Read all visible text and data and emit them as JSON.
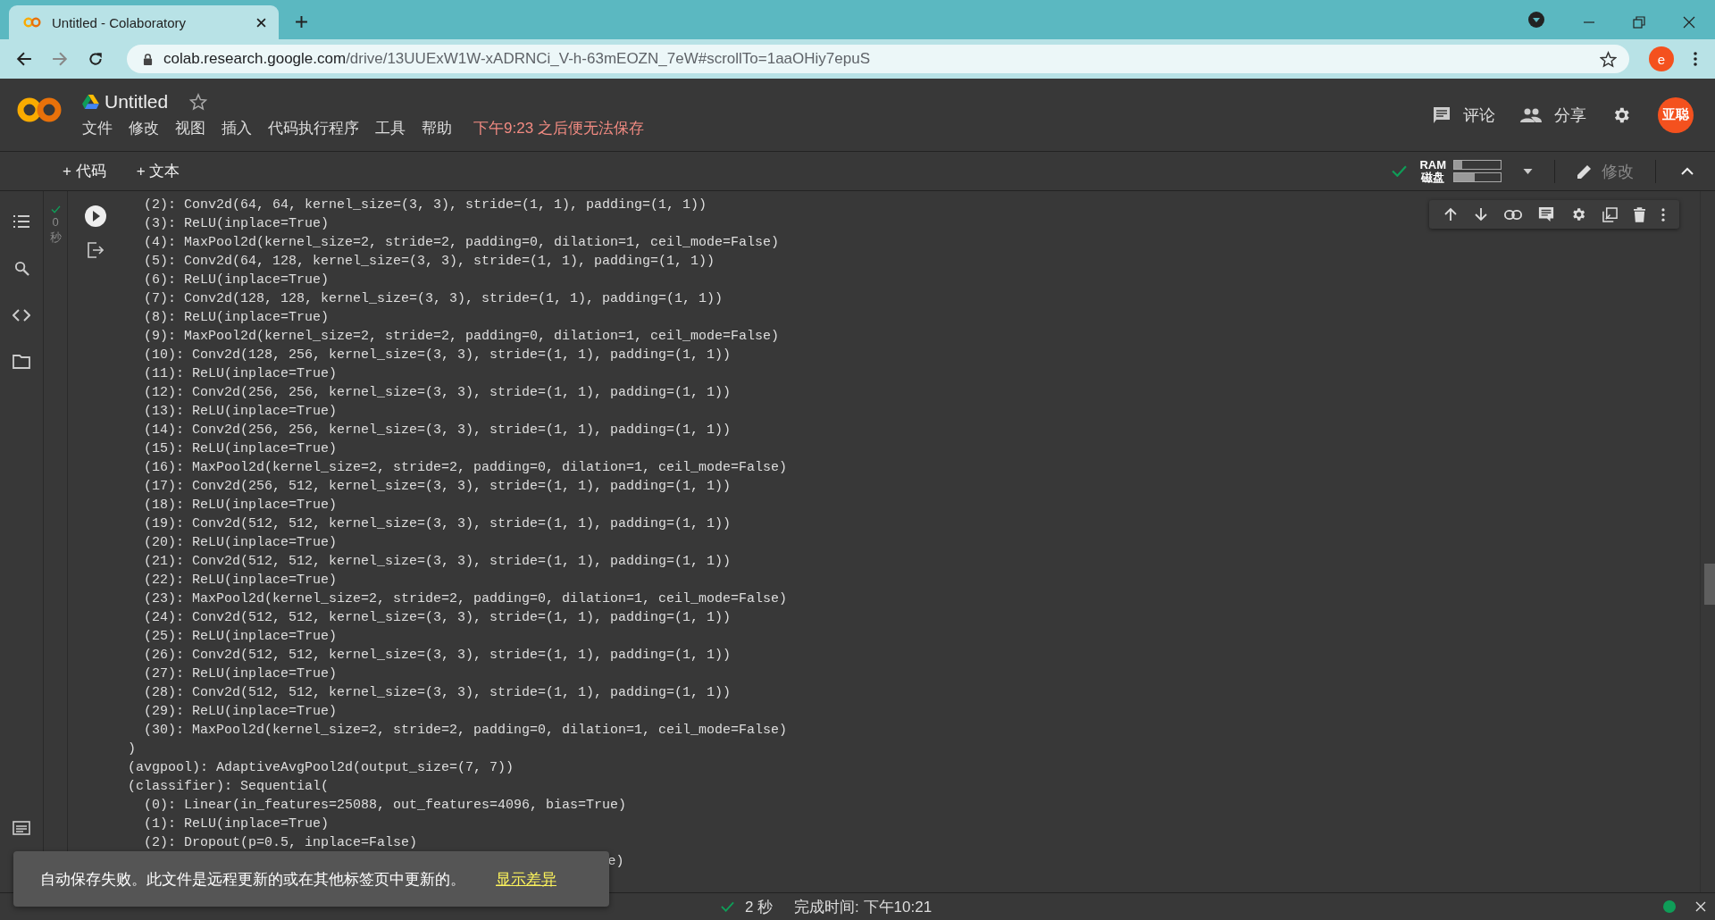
{
  "browser": {
    "tab": {
      "title": "Untitled - Colaboratory",
      "selected": true
    },
    "url_host": "colab.research.google.com",
    "url_path": "/drive/13UUExW1W-xADRNCi_V-h-63mEOZN_7eW#scrollTo=1aaOHiy7epuS",
    "profile_initial": "e"
  },
  "notebook": {
    "title": "Untitled",
    "menu": [
      "文件",
      "修改",
      "视图",
      "插入",
      "代码执行程序",
      "工具",
      "帮助"
    ],
    "save_warning": "下午9:23 之后便无法保存",
    "actions": [
      {
        "kind": "comment",
        "label": "评论"
      },
      {
        "kind": "share",
        "label": "分享"
      }
    ],
    "avatar_text": "亚聪"
  },
  "toolbar": {
    "add_buttons": [
      "+ 代码",
      "+ 文本"
    ],
    "resources": [
      {
        "label": "RAM",
        "level": 0.18
      },
      {
        "label": "磁盘",
        "level": 0.45
      }
    ],
    "edit_label": "修改"
  },
  "cell": {
    "exec_count": "0",
    "exec_unit": "秒",
    "output_lines": [
      "  (2): Conv2d(64, 64, kernel_size=(3, 3), stride=(1, 1), padding=(1, 1))",
      "  (3): ReLU(inplace=True)",
      "  (4): MaxPool2d(kernel_size=2, stride=2, padding=0, dilation=1, ceil_mode=False)",
      "  (5): Conv2d(64, 128, kernel_size=(3, 3), stride=(1, 1), padding=(1, 1))",
      "  (6): ReLU(inplace=True)",
      "  (7): Conv2d(128, 128, kernel_size=(3, 3), stride=(1, 1), padding=(1, 1))",
      "  (8): ReLU(inplace=True)",
      "  (9): MaxPool2d(kernel_size=2, stride=2, padding=0, dilation=1, ceil_mode=False)",
      "  (10): Conv2d(128, 256, kernel_size=(3, 3), stride=(1, 1), padding=(1, 1))",
      "  (11): ReLU(inplace=True)",
      "  (12): Conv2d(256, 256, kernel_size=(3, 3), stride=(1, 1), padding=(1, 1))",
      "  (13): ReLU(inplace=True)",
      "  (14): Conv2d(256, 256, kernel_size=(3, 3), stride=(1, 1), padding=(1, 1))",
      "  (15): ReLU(inplace=True)",
      "  (16): MaxPool2d(kernel_size=2, stride=2, padding=0, dilation=1, ceil_mode=False)",
      "  (17): Conv2d(256, 512, kernel_size=(3, 3), stride=(1, 1), padding=(1, 1))",
      "  (18): ReLU(inplace=True)",
      "  (19): Conv2d(512, 512, kernel_size=(3, 3), stride=(1, 1), padding=(1, 1))",
      "  (20): ReLU(inplace=True)",
      "  (21): Conv2d(512, 512, kernel_size=(3, 3), stride=(1, 1), padding=(1, 1))",
      "  (22): ReLU(inplace=True)",
      "  (23): MaxPool2d(kernel_size=2, stride=2, padding=0, dilation=1, ceil_mode=False)",
      "  (24): Conv2d(512, 512, kernel_size=(3, 3), stride=(1, 1), padding=(1, 1))",
      "  (25): ReLU(inplace=True)",
      "  (26): Conv2d(512, 512, kernel_size=(3, 3), stride=(1, 1), padding=(1, 1))",
      "  (27): ReLU(inplace=True)",
      "  (28): Conv2d(512, 512, kernel_size=(3, 3), stride=(1, 1), padding=(1, 1))",
      "  (29): ReLU(inplace=True)",
      "  (30): MaxPool2d(kernel_size=2, stride=2, padding=0, dilation=1, ceil_mode=False)",
      ")",
      "(avgpool): AdaptiveAvgPool2d(output_size=(7, 7))",
      "(classifier): Sequential(",
      "  (0): Linear(in_features=25088, out_features=4096, bias=True)",
      "  (1): ReLU(inplace=True)",
      "  (2): Dropout(p=0.5, inplace=False)"
    ],
    "covered_tail": "e)"
  },
  "toast": {
    "message": "自动保存失败。此文件是远程更新的或在其他标签页中更新的。",
    "link": "显示差异"
  },
  "status_bar": {
    "duration": "2 秒",
    "completed": "完成时间: 下午10:21",
    "connected": true
  }
}
